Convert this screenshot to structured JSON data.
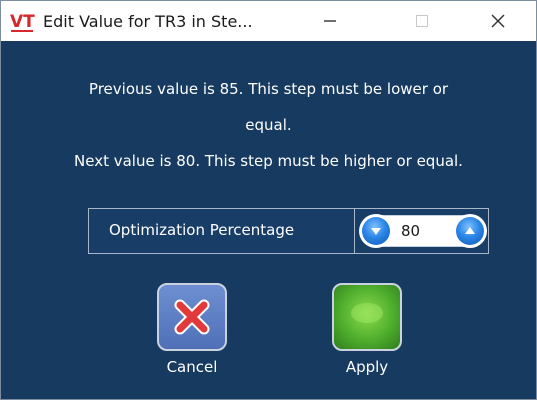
{
  "window": {
    "title": "Edit Value for TR3 in Ste...",
    "logo_text": "VT",
    "controls": [
      "minimize",
      "maximize",
      "close"
    ]
  },
  "messages": {
    "previous_line1": "Previous value is 85. This step must be lower or",
    "previous_line2": "equal.",
    "next": "Next value is 80. This step must be higher or equal."
  },
  "optimization": {
    "label": "Optimization Percentage",
    "value": "80"
  },
  "actions": {
    "cancel_label": "Cancel",
    "apply_label": "Apply"
  },
  "colors": {
    "background": "#173a61",
    "titlebar": "#ffffff",
    "accent_blue": "#2a86e6",
    "cancel_x": "#e23a3a",
    "apply_green": "#4fae2d"
  }
}
